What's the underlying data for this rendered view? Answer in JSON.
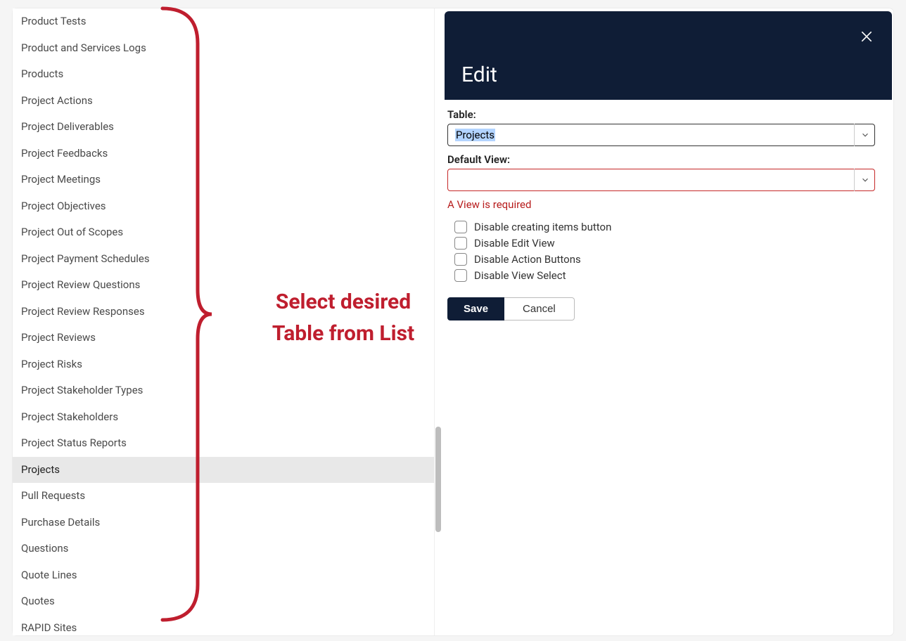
{
  "dropdown": {
    "items": [
      {
        "label": "Product Tests",
        "selected": false
      },
      {
        "label": "Product and Services Logs",
        "selected": false
      },
      {
        "label": "Products",
        "selected": false
      },
      {
        "label": "Project Actions",
        "selected": false
      },
      {
        "label": "Project Deliverables",
        "selected": false
      },
      {
        "label": "Project Feedbacks",
        "selected": false
      },
      {
        "label": "Project Meetings",
        "selected": false
      },
      {
        "label": "Project Objectives",
        "selected": false
      },
      {
        "label": "Project Out of Scopes",
        "selected": false
      },
      {
        "label": "Project Payment Schedules",
        "selected": false
      },
      {
        "label": "Project Review Questions",
        "selected": false
      },
      {
        "label": "Project Review Responses",
        "selected": false
      },
      {
        "label": "Project Reviews",
        "selected": false
      },
      {
        "label": "Project Risks",
        "selected": false
      },
      {
        "label": "Project Stakeholder Types",
        "selected": false
      },
      {
        "label": "Project Stakeholders",
        "selected": false
      },
      {
        "label": "Project Status Reports",
        "selected": false
      },
      {
        "label": "Projects",
        "selected": true
      },
      {
        "label": "Pull Requests",
        "selected": false
      },
      {
        "label": "Purchase Details",
        "selected": false
      },
      {
        "label": "Questions",
        "selected": false
      },
      {
        "label": "Quote Lines",
        "selected": false
      },
      {
        "label": "Quotes",
        "selected": false
      },
      {
        "label": "RAPID Sites",
        "selected": false
      }
    ]
  },
  "annotation": {
    "text_line1": "Select desired",
    "text_line2": "Table from List",
    "color": "#bf1e2e"
  },
  "panel": {
    "title": "Edit",
    "fields": {
      "table_label": "Table:",
      "table_value": "Projects",
      "default_view_label": "Default View:",
      "default_view_value": "",
      "default_view_error": "A View is required"
    },
    "checkboxes": [
      {
        "label": "Disable creating items button",
        "checked": false
      },
      {
        "label": "Disable Edit View",
        "checked": false
      },
      {
        "label": "Disable Action Buttons",
        "checked": false
      },
      {
        "label": "Disable View Select",
        "checked": false
      }
    ],
    "actions": {
      "save_label": "Save",
      "cancel_label": "Cancel"
    }
  }
}
